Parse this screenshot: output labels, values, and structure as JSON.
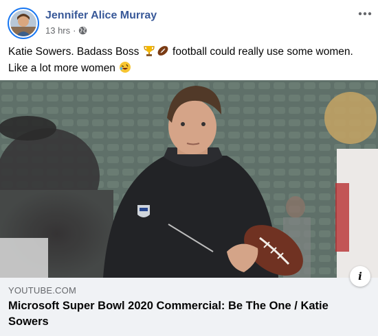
{
  "post": {
    "author": "Jennifer Alice Murray",
    "timestamp": "13 hrs",
    "separator": "·",
    "privacy_icon": "globe-icon",
    "more_icon": "ellipsis-icon",
    "text_line1_a": "Katie Sowers. Badass Boss",
    "text_line1_b": "football could really use some women.",
    "text_line2": "Like a lot more women",
    "emojis": [
      "trophy-emoji",
      "football-emoji",
      "rolling-laughing-emoji"
    ]
  },
  "link_preview": {
    "domain": "YOUTUBE.COM",
    "title": "Microsoft Super Bowl 2020 Commercial: Be The One / Katie Sowers",
    "info_label": "i",
    "image_description_icon": "video-thumbnail"
  },
  "colors": {
    "author_link": "#385898",
    "meta_text": "#65676b",
    "link_bar_bg": "#f0f2f5",
    "avatar_ring": "#1877f2"
  }
}
